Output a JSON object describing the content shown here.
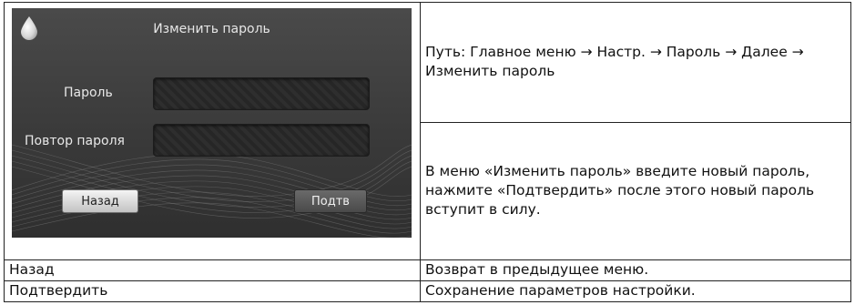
{
  "screen": {
    "title": "Изменить пароль",
    "password_label": "Пароль",
    "repeat_label": "Повтор пароля",
    "back_button": "Назад",
    "confirm_button": "Подтв",
    "icon": "drop-icon"
  },
  "info": {
    "path": "Путь: Главное меню → Настр. → Пароль → Далее → Изменить пароль",
    "description": "В меню «Изменить пароль» введите новый пароль, нажмите «Подтвердить» после этого новый пароль вступит в силу."
  },
  "rows": [
    {
      "name": "Назад",
      "description": "Возврат в предыдущее меню."
    },
    {
      "name": "Подтвердить",
      "description": "Сохранение параметров настройки."
    }
  ]
}
